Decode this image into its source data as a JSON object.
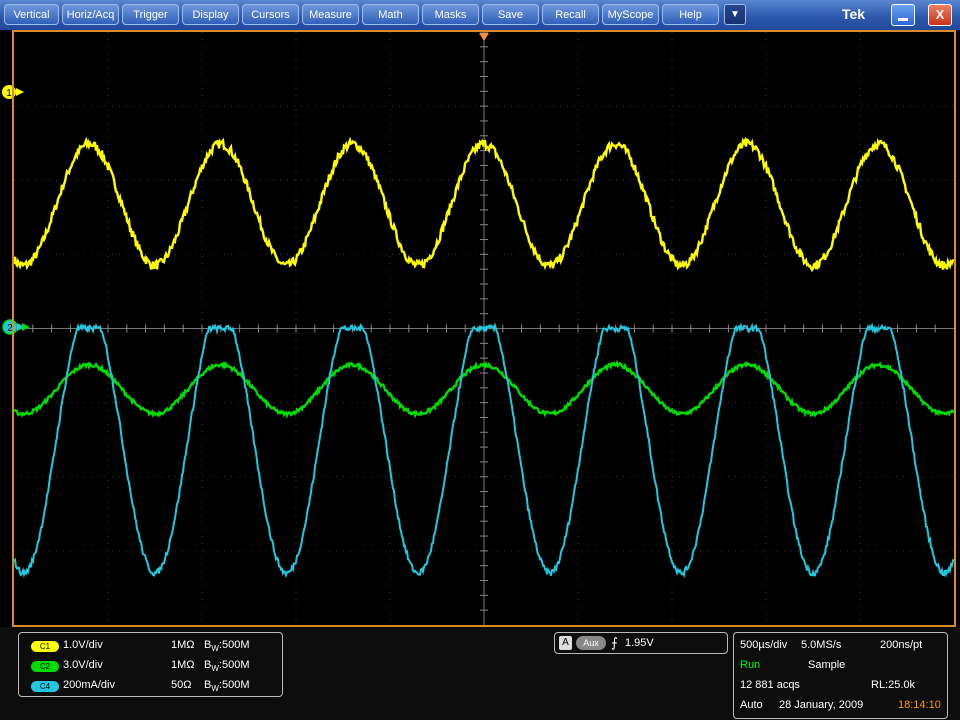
{
  "menu": {
    "items": [
      {
        "label": "Vertical"
      },
      {
        "label": "Horiz/Acq"
      },
      {
        "label": "Trigger"
      },
      {
        "label": "Display"
      },
      {
        "label": "Cursors"
      },
      {
        "label": "Measure"
      },
      {
        "label": "Math"
      },
      {
        "label": "Masks"
      },
      {
        "label": "Save"
      },
      {
        "label": "Recall"
      },
      {
        "label": "MyScope"
      },
      {
        "label": "Help"
      }
    ],
    "more_glyph": "▼"
  },
  "window": {
    "brand": "Tek",
    "close_glyph": "X"
  },
  "colors": {
    "ch1": "#ffff00",
    "ch2": "#00dd00",
    "ch4": "#22c8e0",
    "frame": "#d98a2a",
    "time": "#ff9900",
    "run": "#00ff00"
  },
  "markers": {
    "ch1": "1",
    "ch2": "2"
  },
  "channels": [
    {
      "chip": "C1",
      "scale": "1.0V/div",
      "coupling": "1MΩ",
      "bw_b": "B",
      "bw_sub": "W",
      "bw_val": ":500M"
    },
    {
      "chip": "C2",
      "scale": "3.0V/div",
      "coupling": "1MΩ",
      "bw_b": "B",
      "bw_sub": "W",
      "bw_val": ":500M"
    },
    {
      "chip": "C4",
      "scale": "200mA/div",
      "coupling": "50Ω",
      "bw_b": "B",
      "bw_sub": "W",
      "bw_val": ":500M"
    }
  ],
  "trigger": {
    "mode": "A",
    "source": "Aux",
    "slope": "⨍",
    "level": "1.95V"
  },
  "acquisition": {
    "timebase": "500µs/div",
    "sample_rate": "5.0MS/s",
    "resolution": "200ns/pt",
    "state": "Run",
    "mode": "Sample",
    "acqs": "12 881 acqs",
    "record_length": "RL:25.0k",
    "trigger_mode": "Auto",
    "date": "28 January, 2009",
    "time": "18:14:10"
  },
  "waveforms": {
    "ch1": {
      "period_divs": 1.4,
      "amplitude_divs": 0.82,
      "offset_divs": 1.67,
      "phase": 1.57,
      "noise_divs": 0.06,
      "color": "#ffff00"
    },
    "ch2": {
      "period_divs": 1.4,
      "amplitude_divs": 0.33,
      "offset_divs": -0.82,
      "phase": 1.57,
      "noise_divs": 0.025,
      "color": "#00dd00"
    },
    "ch4": {
      "period_divs": 1.4,
      "amplitude_divs": 1.8,
      "offset_divs": -1.5,
      "phase": 1.57,
      "clip_top_divs": 0.0,
      "noise_divs": 0.04,
      "color": "#22c8e0"
    }
  }
}
